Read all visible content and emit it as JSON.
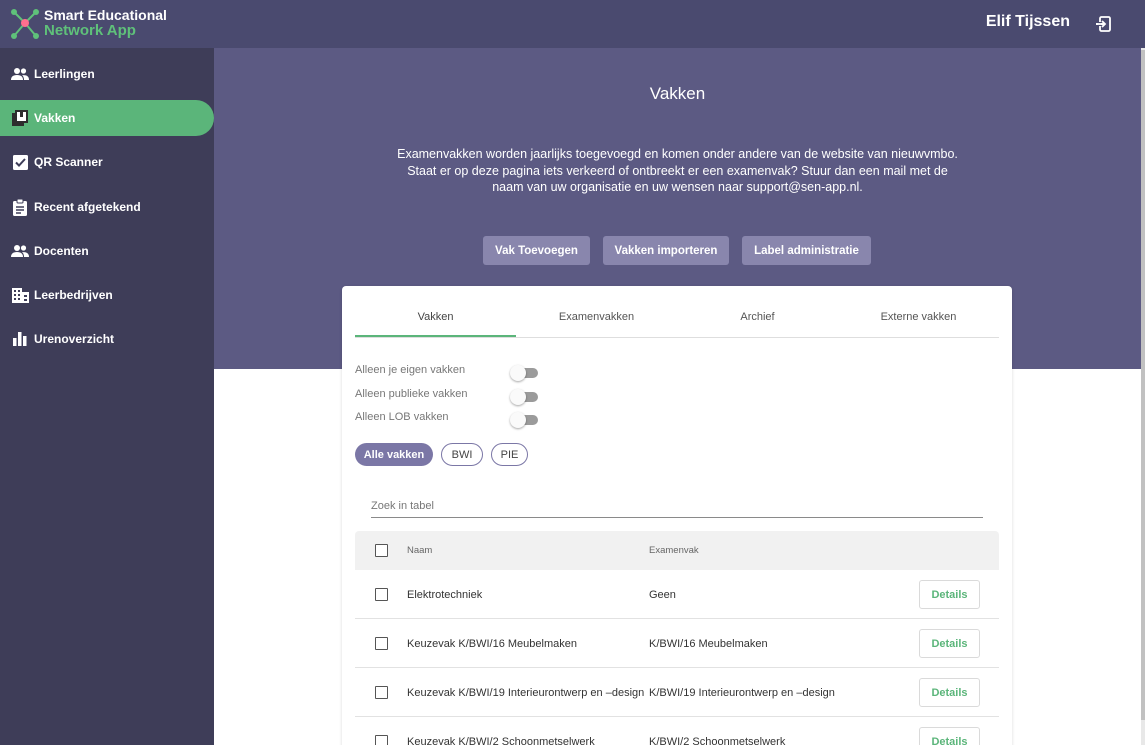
{
  "app": {
    "title_line1": "Smart Educational",
    "title_line2": "Network App",
    "user": "Elif Tijssen"
  },
  "sidebar": {
    "items": [
      {
        "label": "Leerlingen",
        "icon": "people-icon"
      },
      {
        "label": "Vakken",
        "icon": "library-books-icon",
        "active": true
      },
      {
        "label": "QR Scanner",
        "icon": "checklist-icon"
      },
      {
        "label": "Recent afgetekend",
        "icon": "clipboard-icon"
      },
      {
        "label": "Docenten",
        "icon": "people-icon"
      },
      {
        "label": "Leerbedrijven",
        "icon": "building-icon"
      },
      {
        "label": "Urenoverzicht",
        "icon": "bar-chart-icon"
      }
    ]
  },
  "hero": {
    "title": "Vakken",
    "text": "Examenvakken worden jaarlijks toegevoegd en komen onder andere van de website van nieuwvmbo. Staat er op deze pagina iets verkeerd of ontbreekt er een examenvak? Stuur dan een mail met de naam van uw organisatie en uw wensen naar support@sen-app.nl.",
    "buttons": [
      "Vak Toevoegen",
      "Vakken importeren",
      "Label administratie"
    ]
  },
  "tabs": [
    "Vakken",
    "Examenvakken",
    "Archief",
    "Externe vakken"
  ],
  "filters": {
    "toggles": [
      "Alleen je eigen vakken",
      "Alleen publieke vakken",
      "Alleen LOB vakken"
    ],
    "chips": [
      "Alle vakken",
      "BWI",
      "PIE"
    ]
  },
  "search": {
    "placeholder": "Zoek in tabel"
  },
  "table": {
    "headers": [
      "Naam",
      "Examenvak"
    ],
    "action_label": "Details",
    "rows": [
      {
        "naam": "Elektrotechniek",
        "examenvak": "Geen"
      },
      {
        "naam": "Keuzevak K/BWI/16 Meubelmaken",
        "examenvak": "K/BWI/16 Meubelmaken"
      },
      {
        "naam": "Keuzevak K/BWI/19 Interieurontwerp en –design",
        "examenvak": "K/BWI/19 Interieurontwerp en –design"
      },
      {
        "naam": "Keuzevak K/BWI/2 Schoonmetselwerk",
        "examenvak": "K/BWI/2 Schoonmetselwerk"
      }
    ]
  },
  "colors": {
    "topbar": "#4a4a6f",
    "sidebar": "#3e3d58",
    "accent": "#5bb57a",
    "hero": "#5c5a83",
    "arrow": "#f0577e"
  }
}
